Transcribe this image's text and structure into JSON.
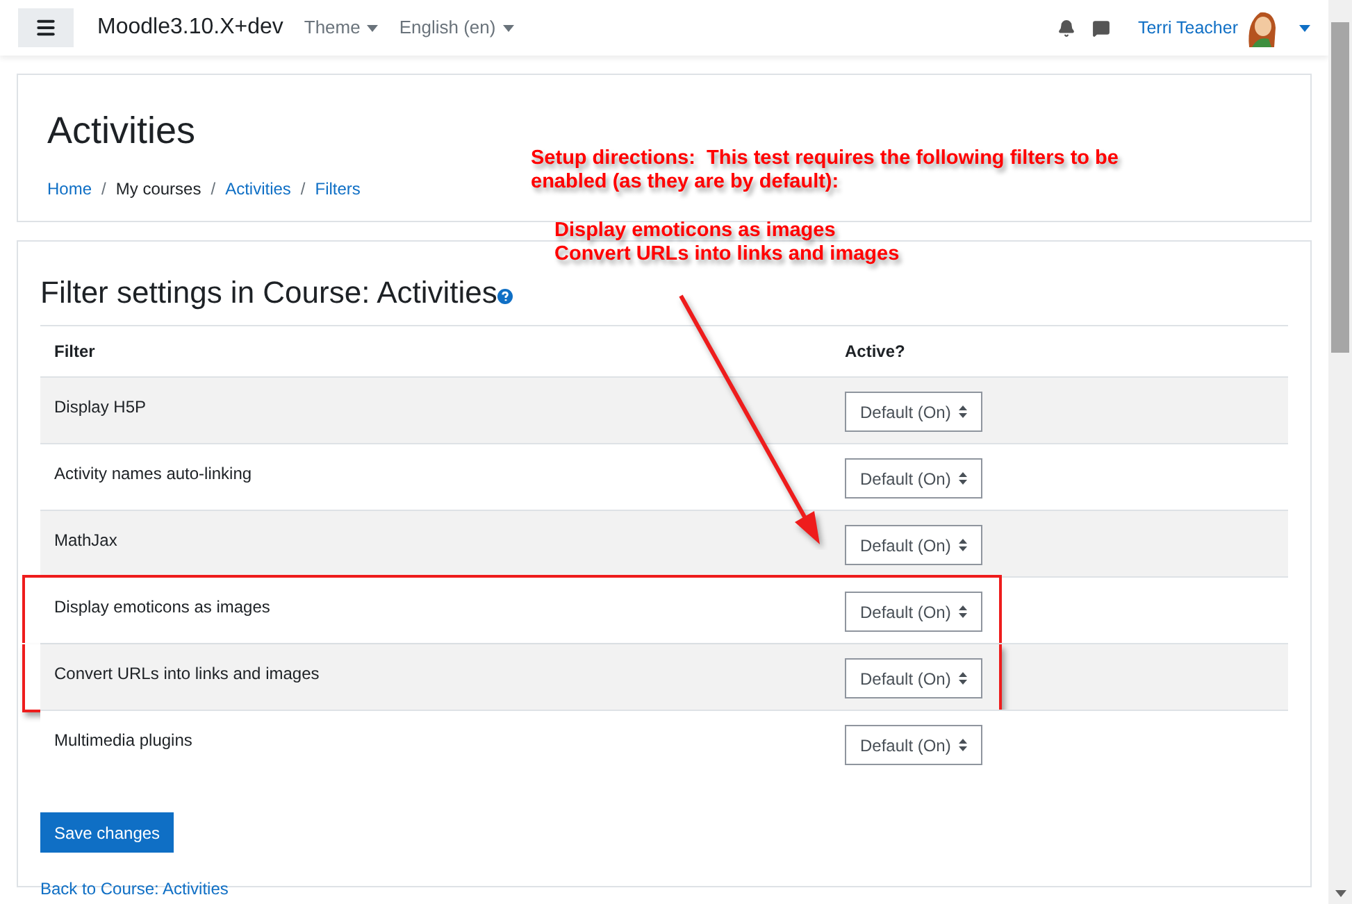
{
  "navbar": {
    "brand": "Moodle3.10.X+dev",
    "menus": [
      "Theme",
      "English (en)"
    ],
    "user_name": "Terri Teacher"
  },
  "header": {
    "title": "Activities",
    "separator": "/",
    "breadcrumb": [
      {
        "label": "Home",
        "link": true
      },
      {
        "label": "My courses",
        "link": false
      },
      {
        "label": "Activities",
        "link": true
      },
      {
        "label": "Filters",
        "link": true
      }
    ]
  },
  "annotation": {
    "directions": "Setup directions:  This test requires the following filters to be enabled (as they are by default):",
    "filters": [
      "Display emoticons as images",
      "Convert URLs into links and images"
    ]
  },
  "settings": {
    "title": "Filter settings in Course: Activities",
    "columns": [
      "Filter",
      "Active?"
    ],
    "rows": [
      {
        "name": "Display H5P",
        "value": "Default (On)",
        "highlighted": false
      },
      {
        "name": "Activity names auto-linking",
        "value": "Default (On)",
        "highlighted": false
      },
      {
        "name": "MathJax",
        "value": "Default (On)",
        "highlighted": false
      },
      {
        "name": "Display emoticons as images",
        "value": "Default (On)",
        "highlighted": true
      },
      {
        "name": "Convert URLs into links and images",
        "value": "Default (On)",
        "highlighted": true
      },
      {
        "name": "Multimedia plugins",
        "value": "Default (On)",
        "highlighted": false
      }
    ],
    "save_button": "Save changes",
    "back_link": "Back to Course: Activities"
  }
}
